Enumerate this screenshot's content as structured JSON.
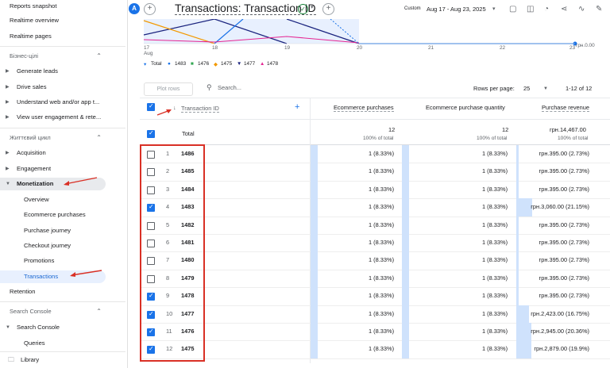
{
  "sidebar": {
    "top_items": [
      "Reports snapshot",
      "Realtime overview",
      "Realtime pages"
    ],
    "section1": "Бізнес-цілі",
    "business_items": [
      "Generate leads",
      "Drive sales",
      "Understand web and/or app t...",
      "View user engagement & rete..."
    ],
    "section2": "Життєвий цикл",
    "lifecycle_items": [
      "Acquisition",
      "Engagement",
      "Monetization"
    ],
    "monetization_sub": [
      "Overview",
      "Ecommerce purchases",
      "Purchase journey",
      "Checkout journey",
      "Promotions",
      "Transactions"
    ],
    "retention": "Retention",
    "section3": "Search Console",
    "search_console_item": "Search Console",
    "queries": "Queries",
    "library": "Library"
  },
  "header": {
    "avatar": "A",
    "title": "Transactions: Transaction ID",
    "custom_label": "Custom",
    "date_range": "Aug 17 - Aug 23, 2025"
  },
  "chart": {
    "x_labels": [
      "17\nAug",
      "18",
      "19",
      "20",
      "21",
      "22",
      "23"
    ],
    "y_right_label": "грн.0.00",
    "legend": [
      {
        "name": "Total",
        "color": "#1a73e8"
      },
      {
        "name": "1483",
        "color": "#1a73e8"
      },
      {
        "name": "1476",
        "color": "#34a853"
      },
      {
        "name": "1475",
        "color": "#f29900"
      },
      {
        "name": "1477",
        "color": "#1a237e"
      },
      {
        "name": "1478",
        "color": "#e52592"
      }
    ]
  },
  "toolbar": {
    "plot_rows": "Plot rows",
    "search_placeholder": "Search...",
    "rows_per_page_label": "Rows per page:",
    "rows_per_page": "25",
    "pagination": "1-12 of 12"
  },
  "table": {
    "col_dim": "Transaction ID",
    "col_purchases": "Ecommerce purchases",
    "col_quantity": "Ecommerce purchase quantity",
    "col_revenue": "Purchase revenue",
    "total_label": "Total",
    "total_purchases": "12",
    "total_quantity": "12",
    "total_revenue": "грн.14,467.00",
    "pct_total": "100% of total",
    "rows": [
      {
        "n": "1",
        "id": "1486",
        "checked": false,
        "pur": "1 (8.33%)",
        "qty": "1 (8.33%)",
        "rev": "грн.395.00 (2.73%)",
        "share": 0.0273
      },
      {
        "n": "2",
        "id": "1485",
        "checked": false,
        "pur": "1 (8.33%)",
        "qty": "1 (8.33%)",
        "rev": "грн.395.00 (2.73%)",
        "share": 0.0273
      },
      {
        "n": "3",
        "id": "1484",
        "checked": false,
        "pur": "1 (8.33%)",
        "qty": "1 (8.33%)",
        "rev": "грн.395.00 (2.73%)",
        "share": 0.0273
      },
      {
        "n": "4",
        "id": "1483",
        "checked": true,
        "pur": "1 (8.33%)",
        "qty": "1 (8.33%)",
        "rev": "грн.3,060.00 (21.15%)",
        "share": 0.2115
      },
      {
        "n": "5",
        "id": "1482",
        "checked": false,
        "pur": "1 (8.33%)",
        "qty": "1 (8.33%)",
        "rev": "грн.395.00 (2.73%)",
        "share": 0.0273
      },
      {
        "n": "6",
        "id": "1481",
        "checked": false,
        "pur": "1 (8.33%)",
        "qty": "1 (8.33%)",
        "rev": "грн.395.00 (2.73%)",
        "share": 0.0273
      },
      {
        "n": "7",
        "id": "1480",
        "checked": false,
        "pur": "1 (8.33%)",
        "qty": "1 (8.33%)",
        "rev": "грн.395.00 (2.73%)",
        "share": 0.0273
      },
      {
        "n": "8",
        "id": "1479",
        "checked": false,
        "pur": "1 (8.33%)",
        "qty": "1 (8.33%)",
        "rev": "грн.395.00 (2.73%)",
        "share": 0.0273
      },
      {
        "n": "9",
        "id": "1478",
        "checked": true,
        "pur": "1 (8.33%)",
        "qty": "1 (8.33%)",
        "rev": "грн.395.00 (2.73%)",
        "share": 0.0273
      },
      {
        "n": "10",
        "id": "1477",
        "checked": true,
        "pur": "1 (8.33%)",
        "qty": "1 (8.33%)",
        "rev": "грн.2,423.00 (16.75%)",
        "share": 0.1675
      },
      {
        "n": "11",
        "id": "1476",
        "checked": true,
        "pur": "1 (8.33%)",
        "qty": "1 (8.33%)",
        "rev": "грн.2,945.00 (20.36%)",
        "share": 0.2036
      },
      {
        "n": "12",
        "id": "1475",
        "checked": true,
        "pur": "1 (8.33%)",
        "qty": "1 (8.33%)",
        "rev": "грн.2,879.00 (19.9%)",
        "share": 0.199
      }
    ]
  }
}
